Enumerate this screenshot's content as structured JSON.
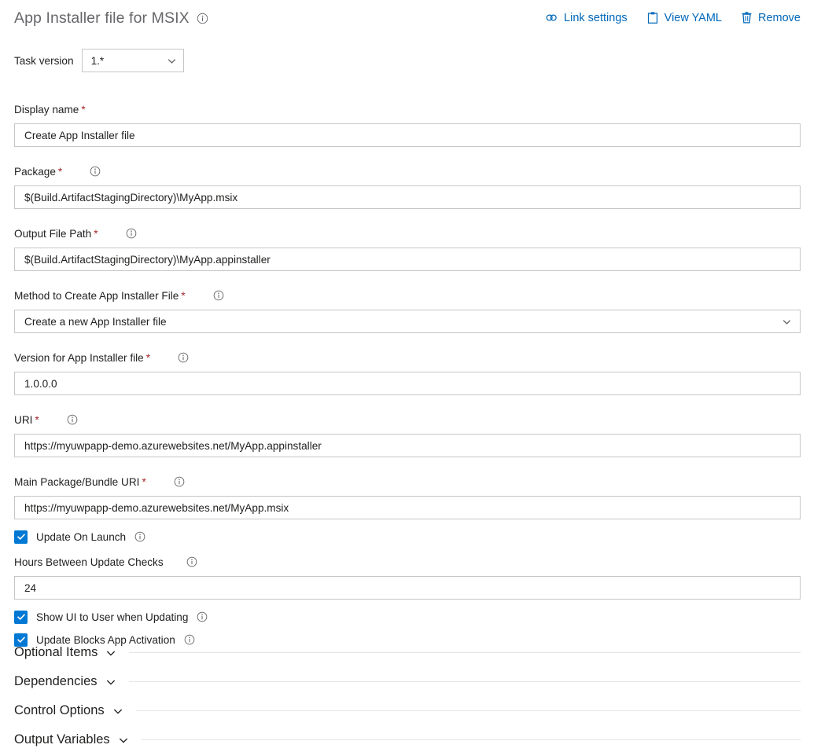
{
  "header": {
    "title": "App Installer file for MSIX",
    "info_icon": "info-icon",
    "toolbar": [
      {
        "label": "Link settings",
        "icon": "link-icon"
      },
      {
        "label": "View YAML",
        "icon": "clipboard-icon"
      },
      {
        "label": "Remove",
        "icon": "trash-icon"
      }
    ]
  },
  "task_version": {
    "label": "Task version",
    "value": "1.*",
    "chevron_icon": "chevron-down-icon"
  },
  "fields": {
    "display_name": {
      "label": "Display name",
      "required": "*",
      "value": "Create App Installer file",
      "has_info": false
    },
    "package": {
      "label": "Package",
      "required": "*",
      "value": "$(Build.ArtifactStagingDirectory)\\MyApp.msix",
      "has_info": true
    },
    "output_file_path": {
      "label": "Output File Path",
      "required": "*",
      "value": "$(Build.ArtifactStagingDirectory)\\MyApp.appinstaller",
      "has_info": true
    },
    "method": {
      "label": "Method to Create App Installer File",
      "required": "*",
      "value": "Create a new App Installer file",
      "has_info": true,
      "chevron_icon": "chevron-down-icon"
    },
    "version": {
      "label": "Version for App Installer file",
      "required": "*",
      "value": "1.0.0.0",
      "has_info": true
    },
    "uri": {
      "label": "URI",
      "required": "*",
      "value": "https://myuwpapp-demo.azurewebsites.net/MyApp.appinstaller",
      "has_info": true
    },
    "main_package_uri": {
      "label": "Main Package/Bundle URI",
      "required": "*",
      "value": "https://myuwpapp-demo.azurewebsites.net/MyApp.msix",
      "has_info": true
    },
    "hours_between_checks": {
      "label": "Hours Between Update Checks",
      "required": "",
      "value": "24",
      "has_info": true
    }
  },
  "checkboxes": [
    {
      "label": "Update On Launch",
      "checked": true,
      "has_info": true
    },
    {
      "label": "Show UI to User when Updating",
      "checked": true,
      "has_info": true
    },
    {
      "label": "Update Blocks App Activation",
      "checked": true,
      "has_info": true
    }
  ],
  "sections": [
    {
      "title": "Optional Items",
      "chevron_icon": "chevron-down-icon"
    },
    {
      "title": "Dependencies",
      "chevron_icon": "chevron-down-icon"
    },
    {
      "title": "Control Options",
      "chevron_icon": "chevron-down-icon"
    },
    {
      "title": "Output Variables",
      "chevron_icon": "chevron-down-icon"
    }
  ],
  "colors": {
    "accent": "#0078d4",
    "link": "#0067b8",
    "required": "#a4262c",
    "border": "#c8c6c4",
    "title": "#68666a"
  }
}
